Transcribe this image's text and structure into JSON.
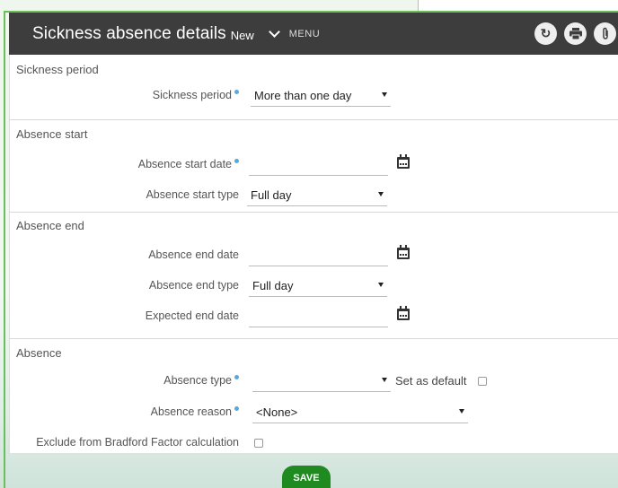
{
  "header": {
    "title": "Sickness absence details",
    "badge": "New",
    "menu_label": "MENU"
  },
  "sections": {
    "period": {
      "title": "Sickness period",
      "sickness_period_label": "Sickness period",
      "sickness_period_value": "More than one day"
    },
    "start": {
      "title": "Absence start",
      "start_date_label": "Absence start date",
      "start_date_value": "",
      "start_type_label": "Absence start type",
      "start_type_value": "Full day"
    },
    "end": {
      "title": "Absence end",
      "end_date_label": "Absence end date",
      "end_date_value": "",
      "end_type_label": "Absence end type",
      "end_type_value": "Full day",
      "expected_end_label": "Expected end date",
      "expected_end_value": ""
    },
    "absence": {
      "title": "Absence",
      "type_label": "Absence type",
      "type_value": "",
      "set_default_label": "Set as default",
      "reason_label": "Absence reason",
      "reason_value": "<None>",
      "bradford_label": "Exclude from Bradford Factor calculation"
    }
  },
  "save_label": "SAVE",
  "colors": {
    "header_bg": "#3d3d3d",
    "save_bg": "#1f8a1f",
    "required_dot": "#58a8dd",
    "frame": "#6bbf5a"
  }
}
